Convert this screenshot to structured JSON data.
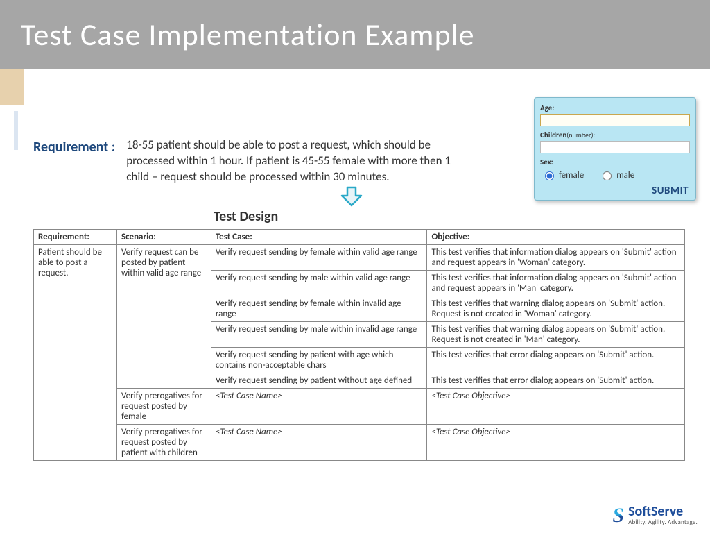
{
  "title": "Test Case Implementation Example",
  "requirement_label": "Requirement :",
  "requirement_text": "18-55 patient should be able to post a request, which should be processed within 1 hour. If patient is 45-55 female with more then 1 child – request should be processed within 30 minutes.",
  "section_title": "Test Design",
  "form": {
    "age_label": "Age:",
    "age_value": "",
    "children_label": "Children",
    "children_hint": "(number):",
    "children_value": "",
    "sex_label": "Sex:",
    "opt_female": "female",
    "opt_male": "male",
    "selected_sex": "female",
    "submit": "SUBMIT"
  },
  "table": {
    "headers": {
      "req": "Requirement:",
      "scen": "Scenario:",
      "tc": "Test Case:",
      "obj": "Objective:"
    },
    "req1": "Patient should be able to post a request.",
    "scen1": "Verify request can be posted by patient within valid age range",
    "scen2": "Verify prerogatives for request posted by female",
    "scen3": "Verify prerogatives for request posted by patient with children",
    "r1_tc": "Verify request sending by female within valid age range",
    "r1_obj": "This test verifies that information dialog appears on 'Submit' action and request appears in 'Woman' category.",
    "r2_tc": "Verify request sending by male within valid age range",
    "r2_obj": "This test verifies that information dialog appears on 'Submit' action and request appears in 'Man' category.",
    "r3_tc": "Verify request sending by female within invalid age range",
    "r3_obj": "This test verifies that warning dialog appears on 'Submit' action. Request is not created in 'Woman' category.",
    "r4_tc": "Verify request sending by male within invalid age range",
    "r4_obj": "This test verifies that warning dialog appears on 'Submit' action. Request is not created in 'Man' category.",
    "r5_tc": "Verify request sending by patient with age which contains non-acceptable chars",
    "r5_obj": "This test verifies that error dialog appears on 'Submit' action.",
    "r6_tc": "Verify request sending by patient without age defined",
    "r6_obj": "This test verifies that error dialog appears on 'Submit' action.",
    "placeholder_tc": "<Test Case Name>",
    "placeholder_obj": "<Test Case Objective>"
  },
  "logo": {
    "brand": "SoftServe",
    "tagline": "Ability. Agility. Advantage."
  }
}
